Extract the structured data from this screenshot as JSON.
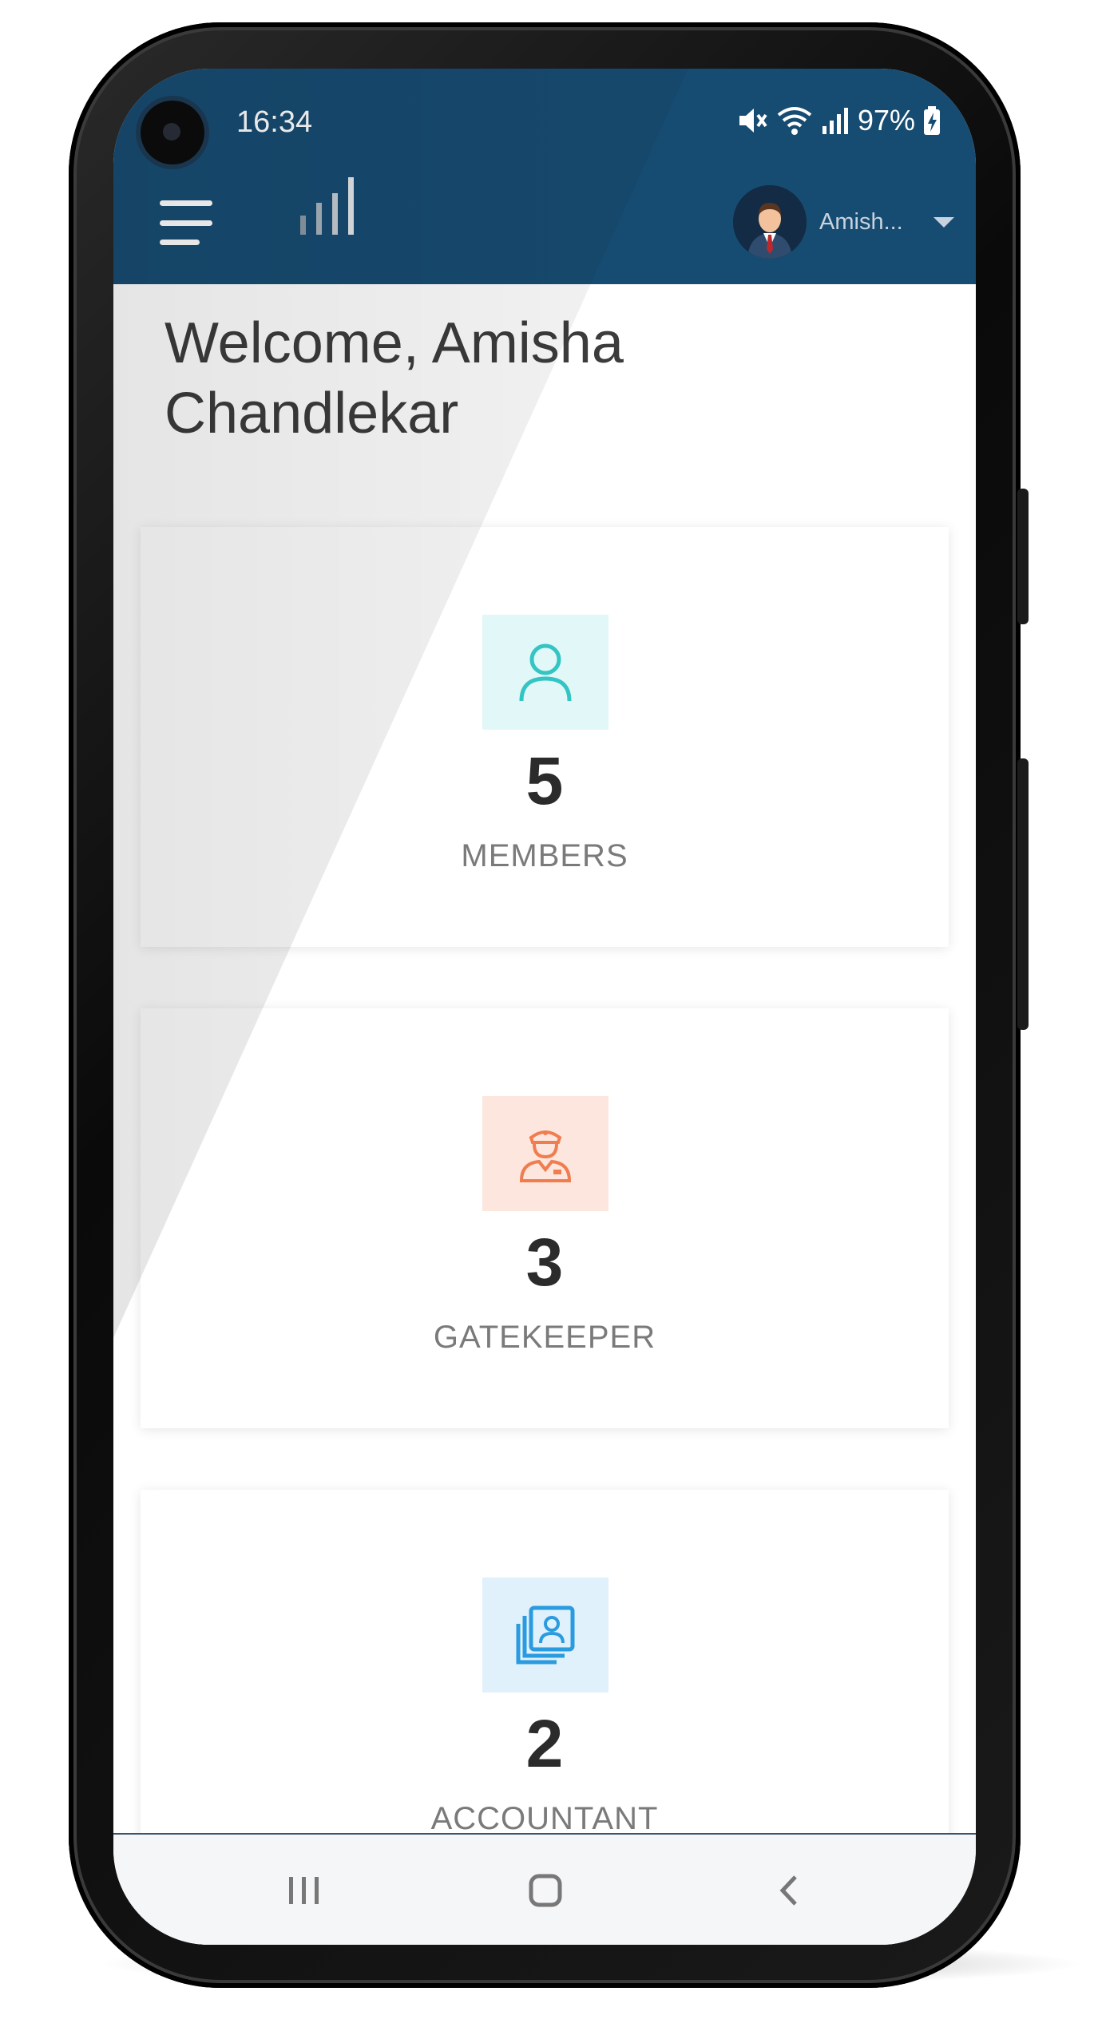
{
  "status_bar": {
    "time": "16:34",
    "battery": "97%",
    "icons": [
      "mute-icon",
      "wifi-icon",
      "signal-icon",
      "battery-charging-icon"
    ]
  },
  "header": {
    "menu_icon": "hamburger-menu-icon",
    "profile_name": "Amish...",
    "background_color": "#174c72"
  },
  "main": {
    "welcome": "Welcome, Amisha Chandlekar",
    "cards": [
      {
        "count": "5",
        "label": "MEMBERS",
        "icon": "member-icon",
        "icon_bg": "#e2f7f7",
        "icon_color": "#33c4c4"
      },
      {
        "count": "3",
        "label": "GATEKEEPER",
        "icon": "gatekeeper-icon",
        "icon_bg": "#fde6dd",
        "icon_color": "#f07d50"
      },
      {
        "count": "2",
        "label": "ACCOUNTANT",
        "icon": "accountant-icon",
        "icon_bg": "#e0f1fb",
        "icon_color": "#2b9be0"
      }
    ]
  },
  "navbar": {
    "buttons": [
      "recent-apps-icon",
      "home-icon",
      "back-icon"
    ]
  }
}
